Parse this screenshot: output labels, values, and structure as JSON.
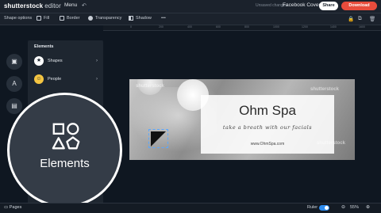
{
  "app": {
    "logo": "shutterstock",
    "logo_suffix": "editor"
  },
  "topbar": {
    "menu_label": "Menu",
    "saved_text": "Unsaved changes",
    "doc_title": "Facebook Cover",
    "share_label": "Share",
    "download_label": "Download"
  },
  "options": {
    "title": "Shape options",
    "fill": "Fill",
    "border": "Border",
    "transparency": "Transparency",
    "shadow": "Shadow",
    "more": "•••"
  },
  "ruler_ticks": [
    "0",
    "200",
    "400",
    "600",
    "800",
    "1000",
    "1200",
    "1400",
    "1600",
    "1800"
  ],
  "panel": {
    "title": "Elements",
    "items": [
      {
        "label": "Shapes",
        "icon": "star-icon"
      },
      {
        "label": "People",
        "icon": "smiley-icon"
      }
    ]
  },
  "spotlight": {
    "label": "Elements",
    "icon": "shapes-icon"
  },
  "canvas": {
    "title": "Ohm Spa",
    "tagline": "take a breath with our facials",
    "url": "www.OhmSpa.com",
    "watermark": "shutterstock"
  },
  "bottombar": {
    "pages_label": "Pages",
    "ruler_label": "Ruler",
    "zoom": "55%"
  },
  "colors": {
    "accent": "#2d8cf0",
    "download": "#e74c3c"
  }
}
